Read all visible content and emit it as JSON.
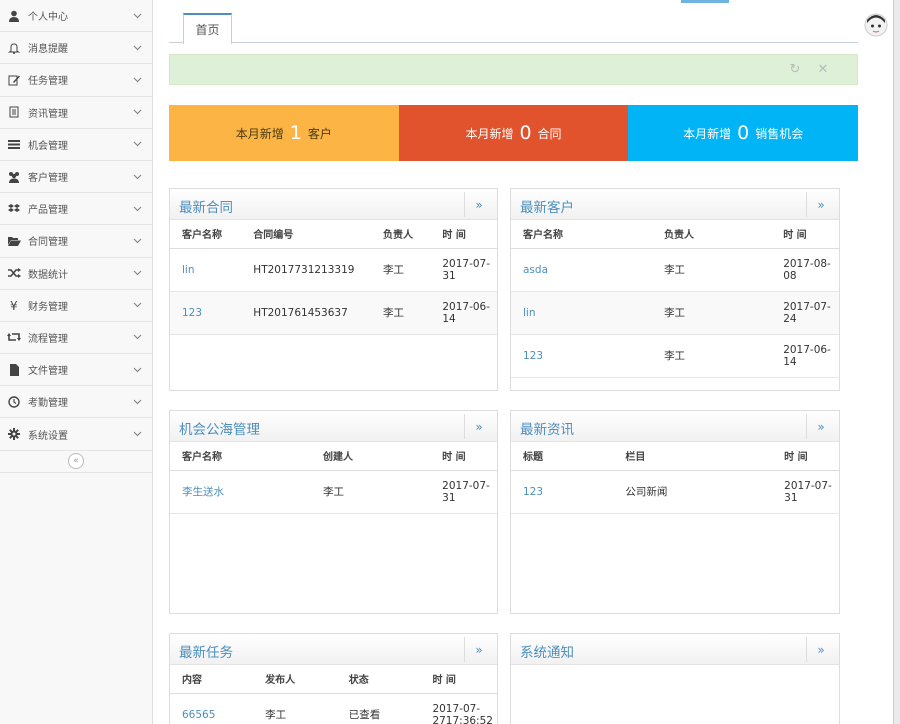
{
  "sidebar": {
    "items": [
      {
        "label": "个人中心",
        "icon": "user-icon"
      },
      {
        "label": "消息提醒",
        "icon": "bell-icon"
      },
      {
        "label": "任务管理",
        "icon": "edit-icon"
      },
      {
        "label": "资讯管理",
        "icon": "document-icon"
      },
      {
        "label": "机会管理",
        "icon": "list-icon"
      },
      {
        "label": "客户管理",
        "icon": "users-icon"
      },
      {
        "label": "产品管理",
        "icon": "dropbox-icon"
      },
      {
        "label": "合同管理",
        "icon": "folder-open-icon"
      },
      {
        "label": "数据统计",
        "icon": "random-icon"
      },
      {
        "label": "财务管理",
        "icon": "yen-icon"
      },
      {
        "label": "流程管理",
        "icon": "retweet-icon"
      },
      {
        "label": "文件管理",
        "icon": "file-icon"
      },
      {
        "label": "考勤管理",
        "icon": "clock-icon"
      },
      {
        "label": "系统设置",
        "icon": "gear-icon"
      }
    ],
    "collapse_glyph": "«"
  },
  "tabs": [
    {
      "label": "首页"
    }
  ],
  "alert": {
    "refresh_glyph": "↻",
    "close_glyph": "✕"
  },
  "stats": [
    {
      "prefix": "本月新增",
      "value": "1",
      "suffix": "客户",
      "color": "#fcb545"
    },
    {
      "prefix": "本月新增",
      "value": "0",
      "suffix": "合同",
      "color": "#e0532c"
    },
    {
      "prefix": "本月新增",
      "value": "0",
      "suffix": "销售机会",
      "color": "#00b4f5"
    }
  ],
  "panels": {
    "contracts": {
      "title": "最新合同",
      "more": "»",
      "columns": [
        "客户名称",
        "合同编号",
        "负责人",
        "时 间"
      ],
      "rows": [
        [
          "lin",
          "HT2017731213319",
          "李工",
          "2017-07-\n31"
        ],
        [
          "123",
          "HT201761453637",
          "李工",
          "2017-06-\n14"
        ]
      ]
    },
    "customers": {
      "title": "最新客户",
      "more": "»",
      "columns": [
        "客户名称",
        "负责人",
        "时 间"
      ],
      "rows": [
        [
          "asda",
          "李工",
          "2017-08-\n08"
        ],
        [
          "lin",
          "李工",
          "2017-07-\n24"
        ],
        [
          "123",
          "李工",
          "2017-06-\n14"
        ]
      ]
    },
    "opportunities": {
      "title": "机会公海管理",
      "more": "»",
      "columns": [
        "客户名称",
        "创建人",
        "时 间"
      ],
      "rows": [
        [
          "李生送水",
          "李工",
          "2017-07-\n31"
        ]
      ]
    },
    "news": {
      "title": "最新资讯",
      "more": "»",
      "columns": [
        "标题",
        "栏目",
        "时 间"
      ],
      "rows": [
        [
          "123",
          "公司新闻",
          "2017-07-\n31"
        ]
      ]
    },
    "tasks": {
      "title": "最新任务",
      "more": "»",
      "columns": [
        "内容",
        "发布人",
        "状态",
        "时 间"
      ],
      "rows": [
        [
          "66565",
          "李工",
          "已查看",
          "2017-07-\n2717:36:52"
        ]
      ]
    },
    "notices": {
      "title": "系统通知",
      "more": "»"
    }
  },
  "colors": {
    "accent": "#4c8fbd",
    "alert_bg": "#dff0d8"
  }
}
